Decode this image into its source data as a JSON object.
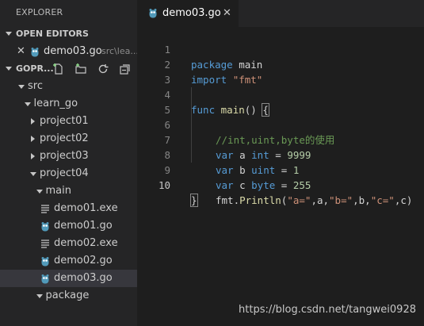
{
  "sidebar": {
    "title": "EXPLORER",
    "open_editors": {
      "header": "OPEN EDITORS",
      "items": [
        {
          "close": "✕",
          "name": "demo03.go",
          "path": "src\\lea..."
        }
      ]
    },
    "workspace": {
      "header": "GOPR...",
      "toolbar_icons": [
        "new-file-icon",
        "new-folder-icon",
        "refresh-icon",
        "collapse-all-icon"
      ]
    },
    "tree": [
      {
        "label": "src",
        "type": "folder",
        "state": "open",
        "depth": 0
      },
      {
        "label": "learn_go",
        "type": "folder",
        "state": "open",
        "depth": 1
      },
      {
        "label": "project01",
        "type": "folder",
        "state": "closed",
        "depth": 2
      },
      {
        "label": "project02",
        "type": "folder",
        "state": "closed",
        "depth": 2
      },
      {
        "label": "project03",
        "type": "folder",
        "state": "closed",
        "depth": 2
      },
      {
        "label": "project04",
        "type": "folder",
        "state": "open",
        "depth": 2
      },
      {
        "label": "main",
        "type": "folder",
        "state": "open",
        "depth": 3
      },
      {
        "label": "demo01.exe",
        "type": "exe",
        "depth": 4
      },
      {
        "label": "demo01.go",
        "type": "go",
        "depth": 4
      },
      {
        "label": "demo02.exe",
        "type": "exe",
        "depth": 4
      },
      {
        "label": "demo02.go",
        "type": "go",
        "depth": 4
      },
      {
        "label": "demo03.go",
        "type": "go",
        "depth": 4,
        "active": true
      },
      {
        "label": "package",
        "type": "folder",
        "state": "open",
        "depth": 3
      }
    ]
  },
  "editor": {
    "tab": {
      "name": "demo03.go",
      "close": "✕"
    },
    "line_numbers": [
      "1",
      "2",
      "3",
      "4",
      "5",
      "6",
      "7",
      "8",
      "9",
      "10"
    ],
    "code": {
      "l1": {
        "kw": "package",
        "rest": " main"
      },
      "l2": {
        "kw": "import",
        "str": "\"fmt\""
      },
      "l4": {
        "kw": "func",
        "fn": "main",
        "rest": "() ",
        "brace": "{"
      },
      "l5": {
        "comment": "//int,uint,byte的使用"
      },
      "l6": {
        "kw": "var",
        "ident": " a ",
        "type": "int",
        "eq": " = ",
        "num": "9999"
      },
      "l7": {
        "kw": "var",
        "ident": " b ",
        "type": "uint",
        "eq": " = ",
        "num": "1"
      },
      "l8": {
        "kw": "var",
        "ident": " c ",
        "type": "byte",
        "eq": " = ",
        "num": "255"
      },
      "l9": {
        "pkg": "fmt.",
        "fn": "Println",
        "open": "(",
        "s1": "\"a=\"",
        "a1": ",a,",
        "s2": "\"b=\"",
        "a2": ",b,",
        "s3": "\"c=\"",
        "a3": ",c)"
      },
      "l10": {
        "brace": "}"
      }
    }
  },
  "watermark": "https://blog.csdn.net/tangwei0928",
  "colors": {
    "sidebar_bg": "#252526",
    "editor_bg": "#1e1e1e",
    "keyword": "#569cd6",
    "string": "#ce9178",
    "number": "#b5cea8",
    "comment": "#6a9955",
    "function": "#dcdcaa",
    "go_icon": "#519aba"
  }
}
